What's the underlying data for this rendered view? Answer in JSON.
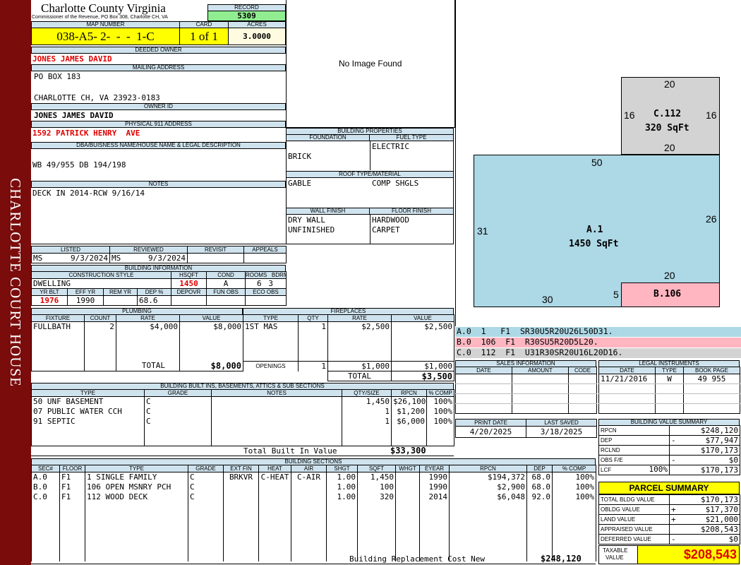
{
  "sidebar": {
    "text": "CHARLOTTE COURT HOUSE",
    "bg": "#7a0c0c"
  },
  "header": {
    "county": "Charlotte County Virginia",
    "office": "Commissioner of the Revenue, PO Box 308, Charlotte CH, VA",
    "record_label": "RECORD",
    "record": "5309",
    "map_label": "MAP NUMBER",
    "map_number": "038-A5- 2-  -  -  1-C",
    "card_label": "CARD",
    "card": "1 of 1",
    "acres_label": "ACRES",
    "acres": "3.0000"
  },
  "owner": {
    "deeded_label": "DEEDED OWNER",
    "deeded": "JONES JAMES DAVID",
    "mailing_label": "MAILING ADDRESS",
    "mail1": "PO BOX 183",
    "mail2": "CHARLOTTE CH, VA 23923-0183",
    "id_label": "OWNER ID",
    "id": "JONES JAMES DAVID",
    "addr_label": "PHYSICAL 911 ADDRESS",
    "addr": "1592 PATRICK HENRY  AVE",
    "dba_label": "DBA/BUISNESS NAME/HOUSE NAME & LEGAL DESCRIPTION",
    "dba": "WB 49/955 DB 194/198",
    "notes_label": "NOTES",
    "notes": "DECK IN 2014-RCW 9/16/14"
  },
  "image": {
    "text": "No Image Found"
  },
  "props": {
    "title": "BUILDING PROPERTIES",
    "foundation_label": "FOUNDATION",
    "foundation": "BRICK",
    "fuel_label": "FUEL TYPE",
    "fuel": "ELECTRIC",
    "roof_label": "ROOF TYPE/MATERIAL",
    "roof1": "GABLE",
    "roof2": "COMP SHGLS",
    "wall_label": "WALL FINISH",
    "wall1": "DRY WALL",
    "wall2": "UNFINISHED",
    "floor_label": "FLOOR FINISH",
    "floor1": "HARDWOOD",
    "floor2": "CARPET"
  },
  "review": {
    "listed_label": "LISTED",
    "reviewed_label": "REVIEWED",
    "revisit_label": "REVISIT",
    "appeals_label": "APPEALS",
    "listed_by": "MS",
    "listed_date": "9/3/2024",
    "reviewed_by": "MS",
    "reviewed_date": "9/3/2024"
  },
  "bldg": {
    "title": "BUILDING INFORMATION",
    "style_label": "CONSTRUCTION STYLE",
    "hsqft_label": "HSQFT",
    "cond_label": "COND",
    "rooms_label": "ROOMS",
    "bdrms_label": "BDRMS",
    "style": "DWELLING",
    "hsqft": "1450",
    "cond": "A",
    "rooms": "6",
    "bdrms": "3",
    "yrblt_label": "YR BLT",
    "effyr_label": "EFF YR",
    "remyr_label": "REM YR",
    "dep_label": "DEP %",
    "depovr_label": "DEPOVR",
    "funobs_label": "FUN OBS",
    "ecoobs_label": "ECO OBS",
    "yrblt": "1976",
    "effyr": "1990",
    "dep": "68.6"
  },
  "plumbing": {
    "title": "PLUMBING",
    "headers": [
      "FIXTURE",
      "COUNT",
      "RATE",
      "VALUE"
    ],
    "rows": [
      {
        "fixture": "FULLBATH",
        "count": "2",
        "rate": "$4,000",
        "value": "$8,000"
      }
    ],
    "total_label": "TOTAL",
    "total": "$8,000"
  },
  "fireplaces": {
    "title": "FIREPLACES",
    "headers": [
      "TYPE",
      "QTY",
      "RATE",
      "VALUE"
    ],
    "rows": [
      {
        "type": "1ST MAS",
        "qty": "1",
        "rate": "$2,500",
        "value": "$2,500"
      }
    ],
    "openings_label": "OPENINGS",
    "openings_qty": "1",
    "openings_rate": "$1,000",
    "openings_value": "$1,000",
    "total_label": "TOTAL",
    "total": "$3,500"
  },
  "builtins": {
    "title": "BUILDING BUILT INS, BASEMENTS, ATTICS & SUB SECTIONS",
    "headers": [
      "TYPE",
      "GRADE",
      "NOTES",
      "QTY/SIZE",
      "RPCN",
      "% COMP"
    ],
    "rows": [
      {
        "type": "50 UNF BASEMENT",
        "grade": "C",
        "qty": "1,450",
        "rpcn": "$26,100",
        "comp": "100%"
      },
      {
        "type": "07 PUBLIC WATER CCH",
        "grade": "C",
        "qty": "1",
        "rpcn": "$1,200",
        "comp": "100%"
      },
      {
        "type": "91 SEPTIC",
        "grade": "C",
        "qty": "1",
        "rpcn": "$6,000",
        "comp": "100%"
      }
    ],
    "total_label": "Total Built In Value",
    "total": "$33,300"
  },
  "sections": {
    "title": "BUILDING SECTIONS",
    "headers": [
      "SEC#",
      "FLOOR",
      "TYPE",
      "GRADE",
      "EXT FIN",
      "HEAT",
      "AIR",
      "SHGT",
      "SQFT",
      "WHGT",
      "EYEAR",
      "RPCN",
      "DEP",
      "% COMP"
    ],
    "rows": [
      {
        "sec": "A.0",
        "floor": "F1",
        "type": "1 SINGLE FAMILY",
        "grade": "C",
        "ext": "BRKVR",
        "heat": "C-HEAT",
        "air": "C-AIR",
        "shgt": "1.00",
        "sqft": "1,450",
        "whgt": "",
        "eyear": "1990",
        "rpcn": "$194,372",
        "dep": "68.0",
        "comp": "100%"
      },
      {
        "sec": "B.0",
        "floor": "F1",
        "type": "106 OPEN MSNRY PCH",
        "grade": "C",
        "ext": "",
        "heat": "",
        "air": "",
        "shgt": "1.00",
        "sqft": "100",
        "whgt": "",
        "eyear": "1990",
        "rpcn": "$2,900",
        "dep": "68.0",
        "comp": "100%"
      },
      {
        "sec": "C.0",
        "floor": "F1",
        "type": "112 WOOD DECK",
        "grade": "C",
        "ext": "",
        "heat": "",
        "air": "",
        "shgt": "1.00",
        "sqft": "320",
        "whgt": "",
        "eyear": "2014",
        "rpcn": "$6,048",
        "dep": "92.0",
        "comp": "100%"
      }
    ],
    "rcn_label": "Building Replacement Cost New",
    "rcn": "$248,120"
  },
  "sketch": {
    "c_label": "C.112",
    "c_area": "320 SqFt",
    "c_top": "20",
    "c_bottom": "20",
    "c_left": "16",
    "c_right": "16",
    "a_label": "A.1",
    "a_area": "1450 SqFt",
    "a_top": "50",
    "a_left": "31",
    "a_right": "26",
    "a_bottom": "30",
    "b_label": "B.106",
    "b_top": "20",
    "b_left": "5",
    "colors": {
      "a": "#add8e6",
      "b": "#ffb6c1",
      "c": "#d3d3d3"
    }
  },
  "legend": [
    {
      "code": "A.0  1   F1  SR30U5R20U26L50D31.",
      "color": "#add8e6"
    },
    {
      "code": "B.0  106  F1  R30SU5R20D5L20.",
      "color": "#ffb6c1"
    },
    {
      "code": "C.0  112  F1  U31R30SR20U16L20D16.",
      "color": "#d3d3d3"
    }
  ],
  "sales": {
    "title": "SALES INFORMATION",
    "headers": [
      "DATE",
      "AMOUNT",
      "CODE"
    ]
  },
  "legal": {
    "title": "LEGAL INSTRUMENTS",
    "headers": [
      "DATE",
      "TYPE",
      "BOOK PAGE"
    ],
    "rows": [
      {
        "date": "11/21/2016",
        "type": "W",
        "book": "49 955"
      }
    ]
  },
  "dates": {
    "print_label": "PRINT DATE",
    "print": "4/20/2025",
    "saved_label": "LAST SAVED",
    "saved": "3/18/2025"
  },
  "value_summary": {
    "title": "BUILDING VALUE SUMMARY",
    "rpcn_label": "RPCN",
    "rpcn": "$248,120",
    "dep_label": "DEP",
    "dep_sign": "-",
    "dep": "$77,947",
    "rclnd_label": "RCLND",
    "rclnd": "$170,173",
    "obs_label": "OBS F/E",
    "obs_sign": "-",
    "obs": "$0",
    "lcf_label": "LCF",
    "lcf_pct": "100%",
    "lcf": "$170,173"
  },
  "parcel": {
    "title": "PARCEL SUMMARY",
    "tbv_label": "TOTAL BLDG VALUE",
    "tbv": "$170,173",
    "obldg_label": "OBLDG VALUE",
    "obldg_sign": "+",
    "obldg": "$17,370",
    "land_label": "LAND VALUE",
    "land_sign": "+",
    "land": "$21,000",
    "appraised_label": "APPRAISED VALUE",
    "appraised": "$208,543",
    "deferred_label": "DEFERRED VALUE",
    "deferred_sign": "-",
    "deferred": "$0",
    "taxable_label1": "TAXABLE",
    "taxable_label2": "VALUE",
    "taxable": "$208,543",
    "accent": "#ffff00"
  }
}
